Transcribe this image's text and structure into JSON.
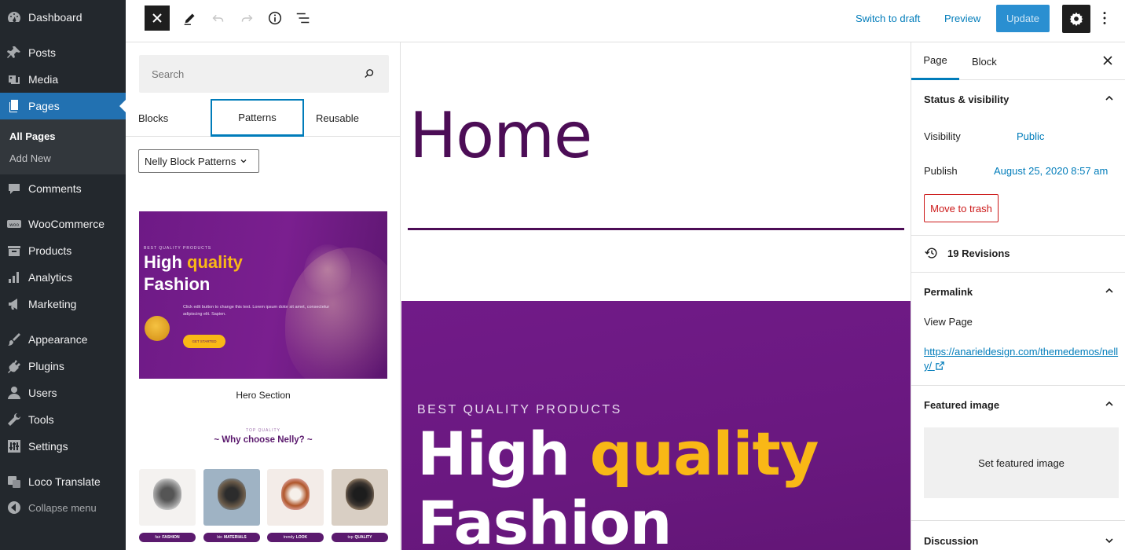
{
  "admin_menu": {
    "dashboard": "Dashboard",
    "posts": "Posts",
    "media": "Media",
    "pages": "Pages",
    "pages_sub": {
      "all": "All Pages",
      "add": "Add New"
    },
    "comments": "Comments",
    "woocommerce": "WooCommerce",
    "products": "Products",
    "analytics": "Analytics",
    "marketing": "Marketing",
    "appearance": "Appearance",
    "plugins": "Plugins",
    "users": "Users",
    "tools": "Tools",
    "settings": "Settings",
    "loco": "Loco Translate",
    "collapse": "Collapse menu"
  },
  "toolbar": {
    "switch_to_draft": "Switch to draft",
    "preview": "Preview",
    "update": "Update"
  },
  "inserter": {
    "search_placeholder": "Search",
    "tabs": [
      "Blocks",
      "Patterns",
      "Reusable"
    ],
    "pattern_category": "Nelly Block Patterns",
    "hero_preview": {
      "pre": "BEST QUALITY PRODUCTS",
      "line1_a": "High",
      "line1_b": "quality",
      "line2": "Fashion",
      "body": "Click edit button to change this text. Lorem ipsum dolor sit amet, consectetur adipiscing elit. Sapien.",
      "cta": "GET STARTED"
    },
    "hero_caption": "Hero Section",
    "why_preview": {
      "pre": "TOP QUALITY",
      "title": "~ Why choose Nelly? ~",
      "labels": [
        {
          "a": "fair",
          "b": "FASHION"
        },
        {
          "a": "bio",
          "b": "MATERIALS"
        },
        {
          "a": "trendy",
          "b": "LOOK"
        },
        {
          "a": "top",
          "b": "QUALITY"
        }
      ]
    }
  },
  "canvas": {
    "title": "Home",
    "hero": {
      "pre": "BEST QUALITY PRODUCTS",
      "line1_a": "High",
      "line1_b": "quality",
      "line2": "Fashion"
    }
  },
  "settings_sidebar": {
    "tabs": [
      "Page",
      "Block"
    ],
    "status_visibility": "Status & visibility",
    "visibility_label": "Visibility",
    "visibility_value": "Public",
    "publish_label": "Publish",
    "publish_value": "August 25, 2020 8:57 am",
    "trash": "Move to trash",
    "revisions": "19 Revisions",
    "permalink": "Permalink",
    "view_page": "View Page",
    "permalink_url": "https://anarieldesign.com/themedemos/nelly/",
    "featured_image": "Featured image",
    "set_featured": "Set featured image",
    "discussion": "Discussion"
  },
  "colors": {
    "wp_blue": "#007cba",
    "admin_dark": "#23282d",
    "brand_purple": "#4c0d56",
    "accent_yellow": "#f9b816",
    "danger": "#cc1818"
  }
}
